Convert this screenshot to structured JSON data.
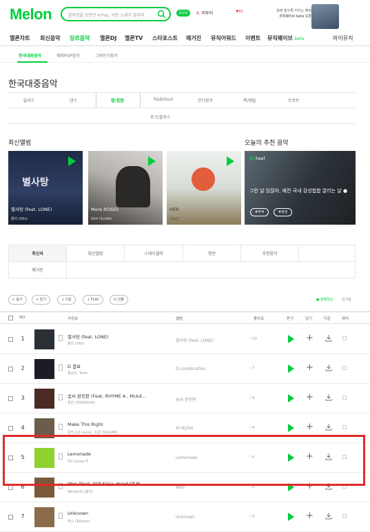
{
  "header": {
    "logo": "Melon",
    "search_placeholder": "블루핫을 방문한 K-Pop, 어떤 노래가 빛추려",
    "badge": "급상승",
    "rank_num": "6.",
    "rank_word": "비투비",
    "bell": "♥60",
    "promo_line1": "항에 필수록 커지는 혜택",
    "promo_line2": "뮤직웨이브 beta 오픈"
  },
  "nav": {
    "items": [
      "멜론차트",
      "최신음악",
      "장르음악",
      "멜론DJ",
      "멜론TV",
      "스타포스트",
      "매거진",
      "뮤직어워드",
      "이벤트",
      "뮤직웨이브"
    ],
    "beta": "beta",
    "my": "마이뮤직"
  },
  "subnav": {
    "items": [
      "한국대중음악",
      "해외POP음악",
      "그외인기장르"
    ]
  },
  "page_title": "한국대중음악",
  "genres": {
    "row1": [
      "발라드",
      "댄스",
      "랩/힙합",
      "R&B/Soul",
      "인디음악",
      "록/메탈",
      "트로트"
    ],
    "row2": [
      "포크/블루스"
    ]
  },
  "latest": {
    "title": "최신앨범",
    "albums": [
      {
        "title": "별사탕 (feat. LONE)",
        "artist": "플리 (Olls)"
      },
      {
        "title": "More ROSES",
        "artist": "ASH ISLAND"
      },
      {
        "title": "HER",
        "artist": "김승민"
      }
    ]
  },
  "recommend": {
    "title": "오늘의 추천 음악",
    "dj_label": "DJ",
    "dj_name": "heef",
    "text": "그런 날 있잖아, 예전 국내 감성힙합 끌리는 날 ●",
    "tags": [
      "#추억",
      "#감성"
    ]
  },
  "tabs": {
    "row1": [
      "최신곡",
      "최신앨범",
      "스테디셀러",
      "명반",
      "추천음악"
    ],
    "row2": [
      "매거진"
    ]
  },
  "actions": [
    "듣기",
    "담기",
    "다운",
    "FLAC",
    "선물"
  ],
  "sort": {
    "on": "● 발매일순",
    "off": "· 인기순"
  },
  "table": {
    "headers": [
      "NO",
      "곡정보",
      "앨범",
      "좋아요",
      "듣기",
      "담기",
      "다운",
      "뮤비"
    ],
    "rows": [
      {
        "no": "1",
        "title": "별사탕 (feat. LONE)",
        "artist": "플리 (Olls)",
        "album": "별사탕 (feat. LONE)",
        "likes": "23"
      },
      {
        "no": "2",
        "title": "D 콤보",
        "artist": "정상수, Trem",
        "album": "D combination",
        "likes": "7"
      },
      {
        "no": "3",
        "title": "솜씨 완전판 (Feat. RHYME A , Mckd...",
        "artist": "창은 (TOMSSON)",
        "album": "솜씨 완전판",
        "likes": "9"
      },
      {
        "no": "4",
        "title": "Make This Right",
        "artist": "뮤직 (Lil Lacre), 소금 (SOGUM)",
        "album": "AI stylist",
        "likes": "4"
      },
      {
        "no": "5",
        "title": "Lemonade",
        "artist": "SS Cancer E",
        "album": "Lemonade",
        "likes": "0"
      },
      {
        "no": "6",
        "title": "Woo (Feat. Still Kinja, Hand Of Pi...",
        "artist": "Woolocki (울락)",
        "album": "Woo",
        "likes": "0"
      },
      {
        "no": "7",
        "title": "Unknown",
        "artist": "박스 (Talksox)",
        "album": "Unknown",
        "likes": "5"
      }
    ],
    "mv_label": "뮤비"
  },
  "colors": {
    "brand": "#00cd3c",
    "highlight": "#e02a2a"
  }
}
